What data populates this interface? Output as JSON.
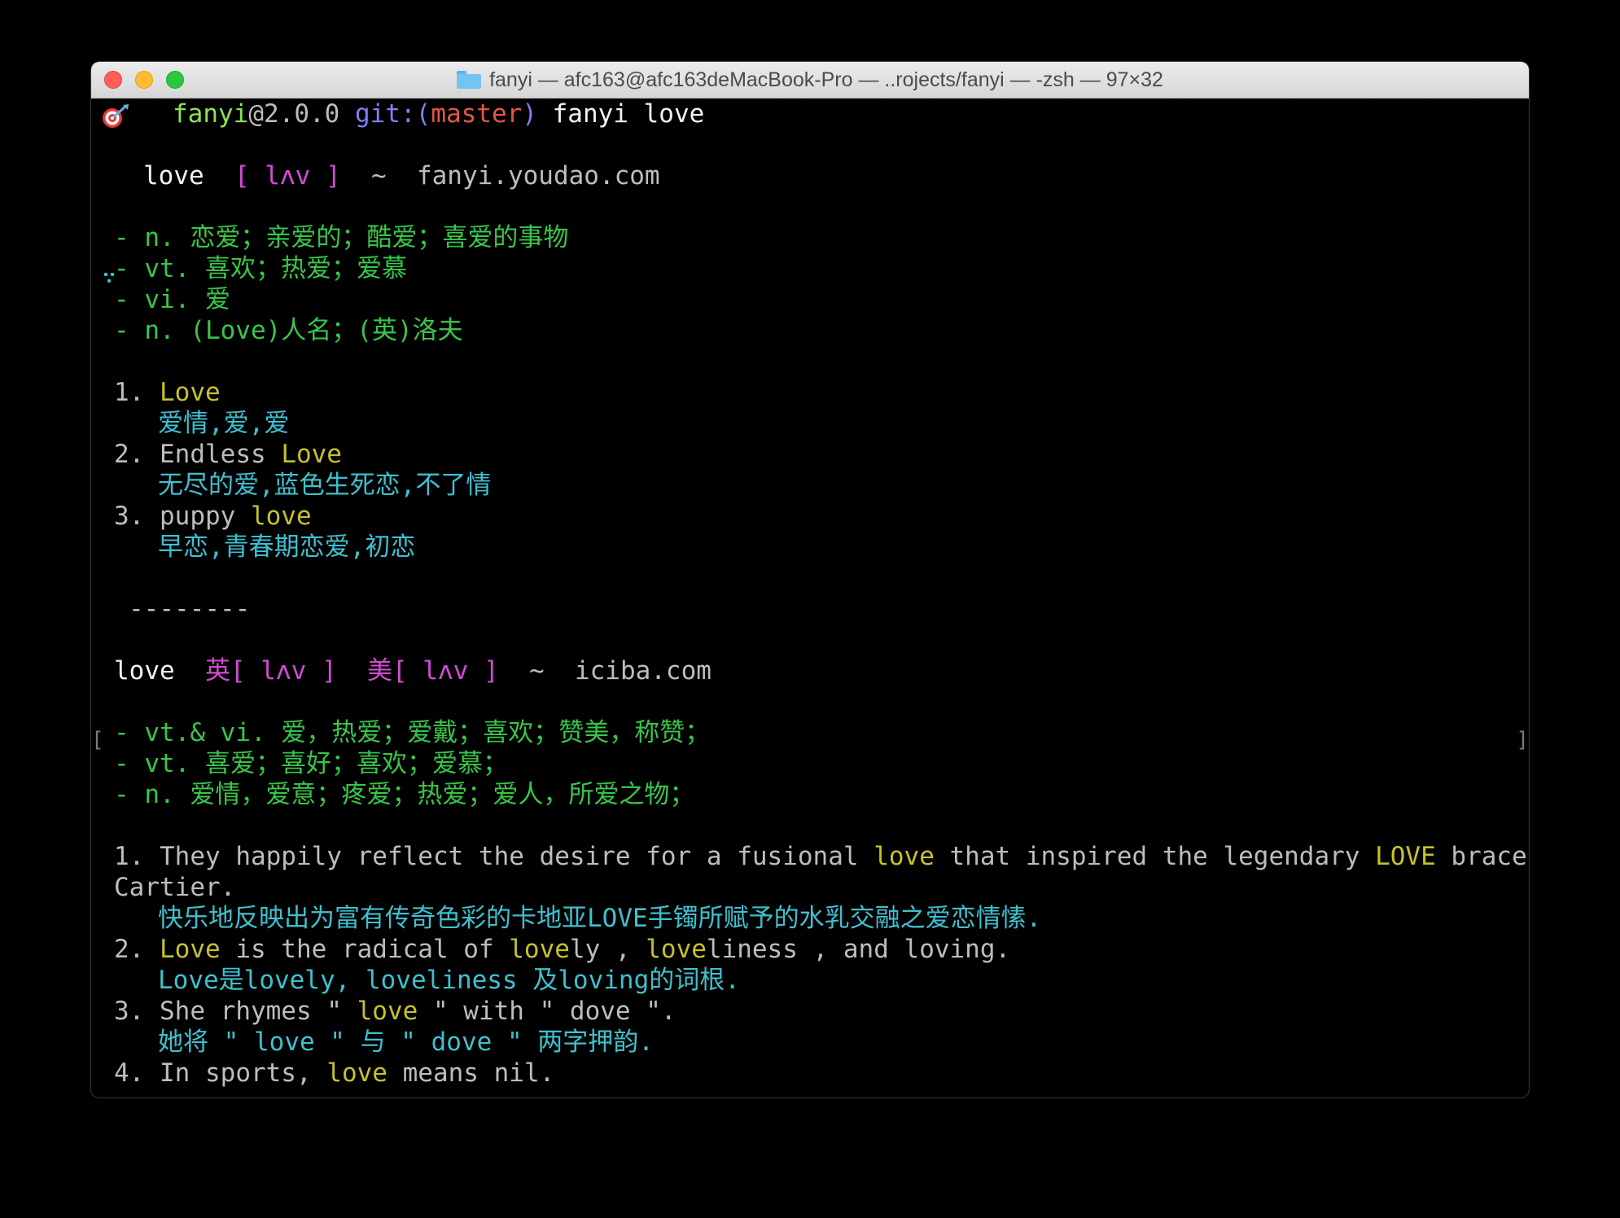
{
  "window": {
    "title": "fanyi — afc163@afc163deMacBook-Pro — ..rojects/fanyi — -zsh — 97×32"
  },
  "prompt": {
    "dir": "fanyi",
    "version": "@2.0.0",
    "git_label": "git:(",
    "branch": "master",
    "git_close": ")",
    "command": "fanyi love"
  },
  "youdao": {
    "word": "love",
    "phonetic": "[ lʌv ]",
    "tilde": "~",
    "source": "fanyi.youdao.com",
    "definitions": [
      "- n. 恋爱；亲爱的；酷爱；喜爱的事物",
      "- vt. 喜欢；热爱；爱慕",
      "- vi. 爱",
      "- n. (Love)人名；(英)洛夫"
    ],
    "phrases": [
      {
        "num": "1. ",
        "pre": "",
        "hl": "Love",
        "post": "",
        "trans": "爱情,爱,爱"
      },
      {
        "num": "2. ",
        "pre": "Endless ",
        "hl": "Love",
        "post": "",
        "trans": "无尽的爱,蓝色生死恋,不了情"
      },
      {
        "num": "3. ",
        "pre": "puppy ",
        "hl": "love",
        "post": "",
        "trans": "早恋,青春期恋爱,初恋"
      }
    ]
  },
  "separator": "--------",
  "bracket_left": "[",
  "bracket_right": "]",
  "iciba": {
    "word": "love",
    "ph_en_label": "英",
    "ph_en": "[ lʌv ]",
    "ph_am_label": "美",
    "ph_am": "[ lʌv ]",
    "tilde": "~",
    "source": "iciba.com",
    "definitions": [
      "- vt.& vi. 爱，热爱；爱戴；喜欢；赞美，称赞；",
      "- vt. 喜爱；喜好；喜欢；爱慕；",
      "- n. 爱情，爱意；疼爱；热爱；爱人，所爱之物；"
    ],
    "sentences": [
      {
        "num": "1. ",
        "parts": [
          "They happily reflect the desire for a fusional ",
          "love",
          " that inspired the legendary ",
          "LOVE",
          " bracelet"
        ],
        "cont": "Cartier.",
        "trans": "快乐地反映出为富有传奇色彩的卡地亚LOVE手镯所赋予的水乳交融之爱恋情愫."
      },
      {
        "num": "2. ",
        "parts": [
          "",
          "Love",
          " is the radical of ",
          "love",
          "ly , ",
          "love",
          "liness , and loving."
        ],
        "trans": "Love是lovely, loveliness 及loving的词根."
      },
      {
        "num": "3. ",
        "parts": [
          "She rhymes \" ",
          "love",
          " \" with \" dove \"."
        ],
        "trans": "她将 \" love \" 与 \" dove \" 两字押韵."
      },
      {
        "num": "4. ",
        "parts": [
          "In sports, ",
          "love",
          " means nil."
        ]
      }
    ]
  }
}
